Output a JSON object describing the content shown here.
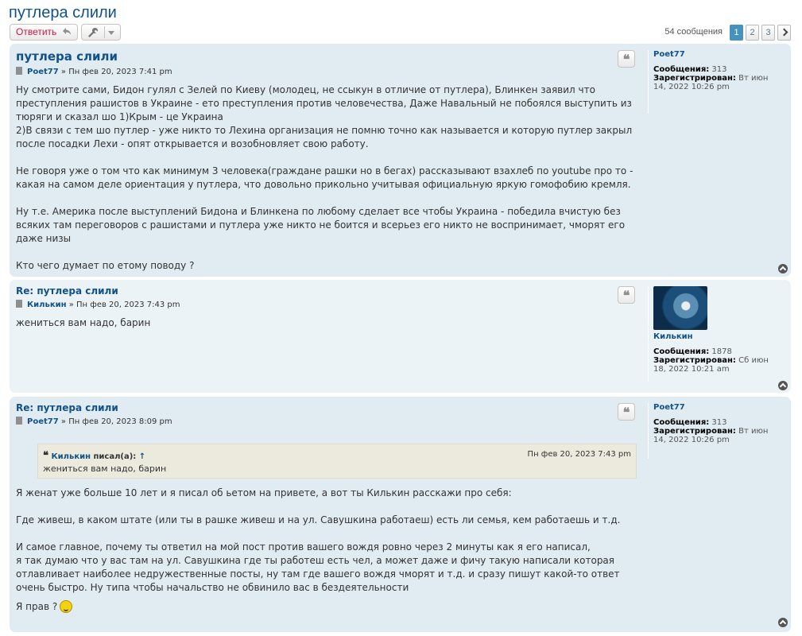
{
  "topic": {
    "title": "путлера слили"
  },
  "actions": {
    "reply_label": "Ответить"
  },
  "pagination": {
    "count": "54 сообщения",
    "pages": [
      "1",
      "2",
      "3"
    ]
  },
  "posts": [
    {
      "title": "путлера слили",
      "author": "Poet77",
      "sep": "»",
      "date": "Пн фев 20, 2023 7:41 pm",
      "paragraphs": [
        "Ну смотрите сами, Бидон гулял с Зелей по Киеву (молодец, не ссыкун в отличие от путлера), Блинкен заявил что преступления рашистов в Украине - ето преступления против человечества, Даже Навальный не побоялся выступить из тюряги и сказал шо 1)Крым - це Украина",
        "2)В связи с тем шо путлер - уже никто то Лехина организация не помню точно как называется и которую путлер закрыл после посадки Лехи - опят открывается и возобновляет свою работу.",
        "",
        "Не говоря уже о том что как минимум 3 человека(граждане рашки но в бегах) рассказывают взахлеб по youtube про то - какая на самом деле ориентация у путлера, что довольно прикольно учитывая официальную яркую гомофобию кремля.",
        "",
        "Ну т.е. Америка после выступлений Бидона и Блинкена по любому сделает все чтобы Украина - победила вчистую без всяких там переговоров с рашистами и путлера уже никто не боится и всерьез его никто не воспринимает, чморят его даже низы",
        "",
        "Кто чего думает по етому поводу ?"
      ],
      "profile": {
        "name": "Poet77",
        "messages_label": "Сообщения:",
        "messages": "313",
        "registered_label": "Зарегистрирован:",
        "registered": "Вт июн 14, 2022 10:26 pm"
      }
    },
    {
      "title": "Re: путлера слили",
      "author": "Килькин",
      "sep": "»",
      "date": "Пн фев 20, 2023 7:43 pm",
      "paragraphs": [
        "жениться вам надо, барин"
      ],
      "profile": {
        "name": "Килькин",
        "messages_label": "Сообщения:",
        "messages": "1878",
        "registered_label": "Зарегистрирован:",
        "registered": "Сб июн 18, 2022 10:21 am"
      }
    },
    {
      "title": "Re: путлера слили",
      "author": "Poet77",
      "sep": "»",
      "date": "Пн фев 20, 2023 8:09 pm",
      "quote": {
        "author": "Килькин",
        "wrote": "писал(а):",
        "arrow": "↑",
        "date": "Пн фев 20, 2023 7:43 pm",
        "text": "жениться вам надо, барин"
      },
      "paragraphs": [
        "Я женат уже больше 10 лет и я писал об ьетом на привете, а вот ты Килькин расскажи про себя:",
        "",
        "Где живеш, в каком штате (или ты в рашке живеш и на ул. Савушкина работаеш) есть ли семья, кем работаешь и т.д.",
        "",
        "И самое главное, почему ты ответил на мой пост против вашего вождя ровно через 2 минуты как я его написал,",
        "я так думаю что у вас там на ул. Савушкина где ты работеш есть чел, а может даже и фичу такую написали которая отлавливает наиболее недружественные посты, ну там где вашего вождя чморят и т.д. и сразу пишут какой-то ответ очень быстро. Ну типа чтобы начальство не обвинило вас в бездеятельности",
        "",
        "Я прав ?"
      ],
      "profile": {
        "name": "Poet77",
        "messages_label": "Сообщения:",
        "messages": "313",
        "registered_label": "Зарегистрирован:",
        "registered": "Вт июн 14, 2022 10:26 pm"
      }
    }
  ],
  "icons": {
    "quote": "quote-icon",
    "reply": "reply-arrow-icon",
    "tools": "wrench-icon",
    "top": "back-to-top-icon",
    "smiley": "smiley-icon"
  },
  "colors": {
    "link": "#105289",
    "post_bg1": "#e1ebf2",
    "post_bg2": "#ecf3f7",
    "reply": "#d31141",
    "active_page": "#4692bf",
    "quote_bg": "#ebeadd"
  }
}
